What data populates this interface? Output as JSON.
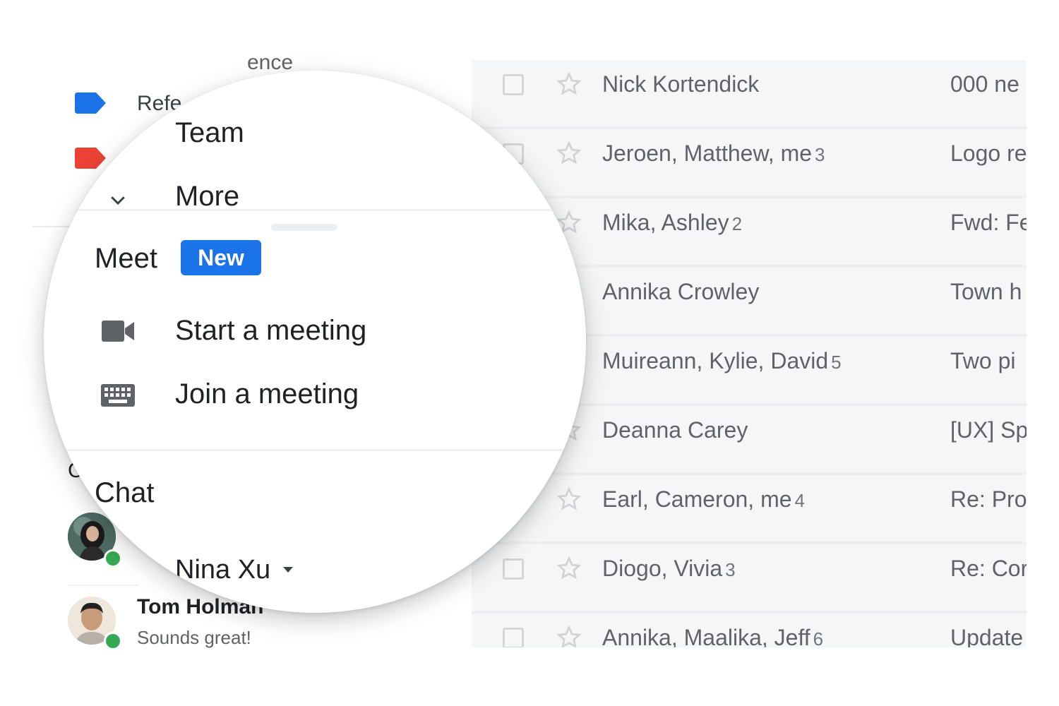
{
  "sidebar": {
    "partial_label_top": "ence",
    "partial_label_ref": "Refe",
    "chat_partial": "C",
    "label_colors": {
      "blue": "#1a73e8",
      "red": "#ea4335"
    },
    "contacts": [
      {
        "name": "Nina Xu",
        "status": "online"
      },
      {
        "name": "Tom Holman",
        "message": "Sounds great!",
        "status": "online"
      }
    ]
  },
  "lens": {
    "team_label": "Team",
    "more_label": "More",
    "more_icon": "chevron-down-icon",
    "meet": {
      "title": "Meet",
      "badge": "New",
      "start_label": "Start a meeting",
      "start_icon": "videocam-icon",
      "join_label": "Join a meeting",
      "join_icon": "keyboard-icon"
    },
    "chat": {
      "title": "Chat",
      "contact_name": "Nina Xu",
      "contact_icon": "caret-down-icon"
    }
  },
  "emails": [
    {
      "sender": "Nick Kortendick",
      "count": "",
      "subject": "000 ne"
    },
    {
      "sender": "Jeroen, Matthew, me",
      "count": "3",
      "subject": "Logo re"
    },
    {
      "sender": "Mika, Ashley",
      "count": "2",
      "subject": "Fwd: Fe"
    },
    {
      "sender": "Annika Crowley",
      "count": "",
      "subject": "Town h"
    },
    {
      "sender": "Muireann, Kylie, David",
      "count": "5",
      "subject": "Two pi"
    },
    {
      "sender": "Deanna Carey",
      "count": "",
      "subject": "[UX] Sp"
    },
    {
      "sender": "Earl, Cameron, me",
      "count": "4",
      "subject": "Re: Pro"
    },
    {
      "sender": "Diogo, Vivia",
      "count": "3",
      "subject": "Re: Cor"
    },
    {
      "sender": "Annika, Maalika, Jeff",
      "count": "6",
      "subject": "Update"
    }
  ]
}
